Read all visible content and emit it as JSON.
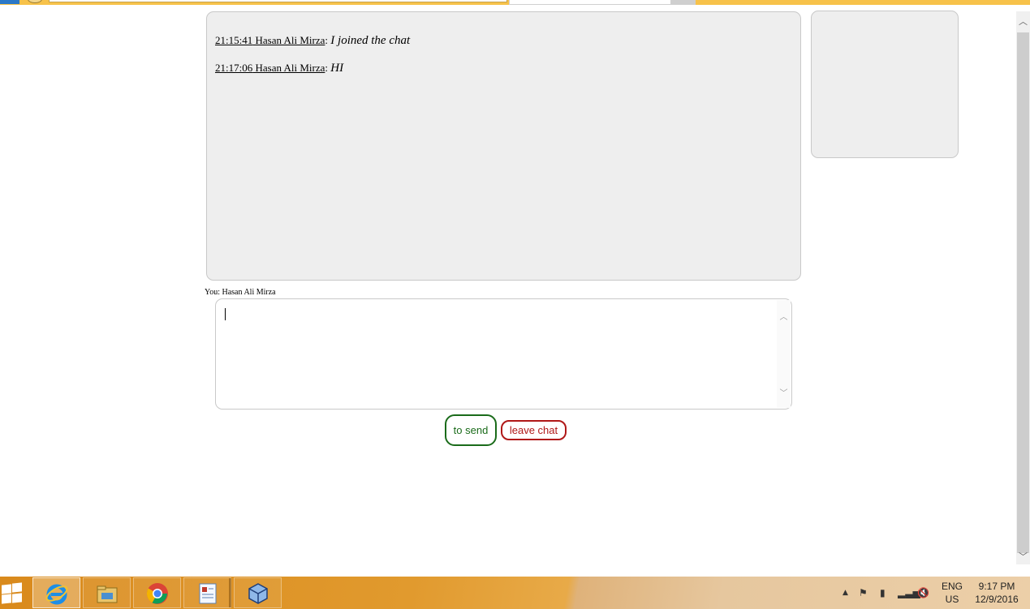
{
  "chat": {
    "messages": [
      {
        "time": "21:15:41",
        "author": "Hasan Ali Mirza",
        "text": "I joined the chat"
      },
      {
        "time": "21:17:06",
        "author": "Hasan Ali Mirza",
        "text": "HI"
      }
    ]
  },
  "composer": {
    "you_label": "You: Hasan Ali Mirza",
    "message_value": "",
    "send_label": "to send",
    "leave_label": "leave chat"
  },
  "colors": {
    "send_accent": "#1a6b1a",
    "leave_accent": "#b01818",
    "panel_bg": "#eeeeee"
  },
  "taskbar": {
    "apps": [
      "internet-explorer-icon",
      "file-explorer-icon",
      "chrome-icon",
      "text-editor-icon",
      "virtualbox-icon"
    ],
    "tray_icons": [
      "show-hidden-icons-icon",
      "action-center-flag-icon",
      "battery-icon",
      "network-signal-icon",
      "volume-muted-icon"
    ],
    "lang_top": "ENG",
    "lang_bottom": "US",
    "time": "9:17 PM",
    "date": "12/9/2016"
  }
}
